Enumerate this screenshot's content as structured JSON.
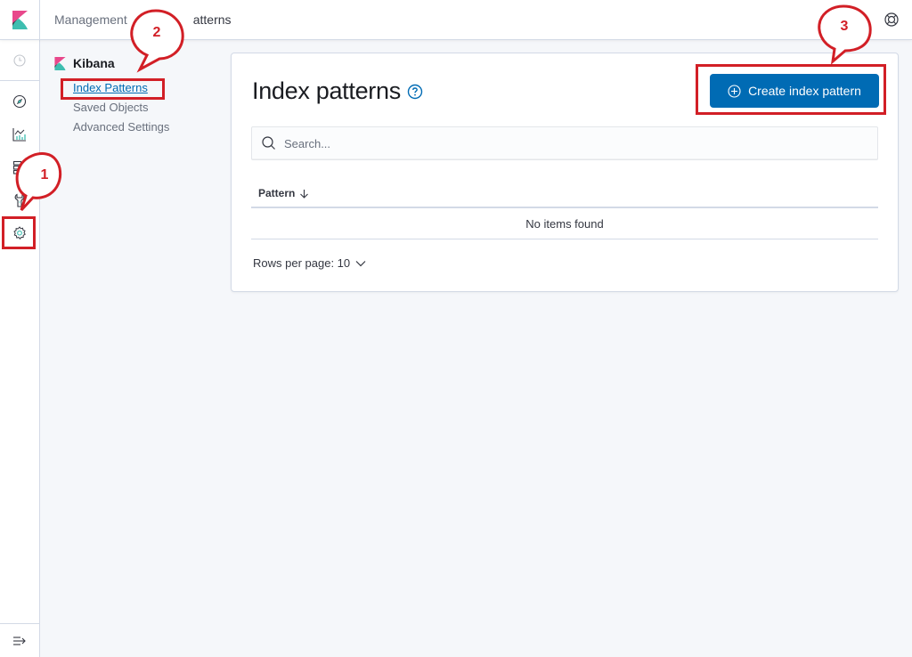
{
  "header": {
    "breadcrumbs": [
      "Management",
      "Index Patterns"
    ],
    "breadcrumb_visible_current": "atterns",
    "help_icon": "lifebuoy-icon"
  },
  "nav": {
    "items": [
      {
        "name": "recently-viewed",
        "icon": "clock-icon"
      },
      {
        "name": "discover",
        "icon": "compass-icon"
      },
      {
        "name": "visualize",
        "icon": "chart-icon"
      },
      {
        "name": "dashboard",
        "icon": "dashboard-icon"
      },
      {
        "name": "dev-tools",
        "icon": "wrench-icon"
      },
      {
        "name": "management",
        "icon": "gear-icon"
      }
    ],
    "collapse_icon": "collapse-nav-icon"
  },
  "sidebar": {
    "title": "Kibana",
    "links": [
      {
        "label": "Index Patterns",
        "active": true
      },
      {
        "label": "Saved Objects",
        "active": false
      },
      {
        "label": "Advanced Settings",
        "active": false
      }
    ]
  },
  "main": {
    "title": "Index patterns",
    "create_button": "Create index pattern",
    "search_placeholder": "Search...",
    "table": {
      "columns": [
        "Pattern"
      ],
      "sort": "descending",
      "empty_message": "No items found"
    },
    "rows_per_page_label": "Rows per page: 10"
  },
  "annotations": [
    {
      "number": "1",
      "target": "management-nav"
    },
    {
      "number": "2",
      "target": "index-patterns-link"
    },
    {
      "number": "3",
      "target": "create-index-pattern-button"
    }
  ],
  "colors": {
    "primary": "#006bb4",
    "annotation": "#d21f26",
    "logo_pink": "#e8488b",
    "logo_teal": "#3ebeb0",
    "logo_dark": "#343741"
  }
}
